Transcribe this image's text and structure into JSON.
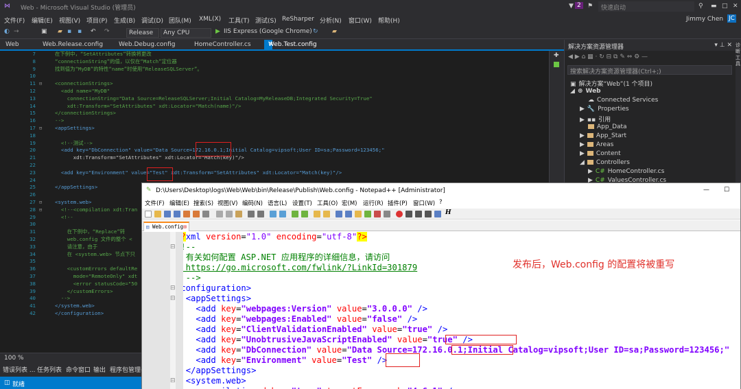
{
  "vs": {
    "title": "Web - Microsoft Visual Studio (管理员)",
    "notif_count": "2",
    "quick_launch": "快速启动",
    "user": "Jimmy Chen",
    "user_initials": "JC",
    "menu": [
      "文件(F)",
      "编辑(E)",
      "视图(V)",
      "项目(P)",
      "生成(B)",
      "调试(D)",
      "团队(M)",
      "XML(X)",
      "工具(T)",
      "测试(S)",
      "ReSharper",
      "分析(N)",
      "窗口(W)",
      "帮助(H)"
    ],
    "toolbar": {
      "config": "Release",
      "platform": "Any CPU",
      "run_label": "IIS Express (Google Chrome)"
    },
    "project_label": "Web",
    "tabs": [
      "Web.Release.config",
      "Web.Debug.config",
      "HomeController.cs",
      "Web.Test.config"
    ],
    "editor_lines": [
      {
        "n": "7",
        "text": "在下例中，“SetAttributes”转换将更改"
      },
      {
        "n": "8",
        "text": "“connectionString”的值，以仅在“Match”定位器"
      },
      {
        "n": "9",
        "text": "找到值为“MyDB”的特性“name”时使用“ReleaseSQLServer”。"
      },
      {
        "n": "10",
        "text": ""
      },
      {
        "n": "11",
        "text": "<connectionStrings>"
      },
      {
        "n": "12",
        "text": "  <add name=\"MyDB\""
      },
      {
        "n": "13",
        "text": "    connectionString=\"Data Source=ReleaseSQLServer;Initial Catalog=MyReleaseDB;Integrated Security=True\""
      },
      {
        "n": "14",
        "text": "    xdt:Transform=\"SetAttributes\" xdt:Locator=\"Match(name)\"/>"
      },
      {
        "n": "15",
        "text": "</connectionStrings>"
      },
      {
        "n": "16",
        "text": "-->"
      },
      {
        "n": "17",
        "text": "<appSettings>"
      },
      {
        "n": "18",
        "text": ""
      },
      {
        "n": "19",
        "text": "  <!--测试-->"
      },
      {
        "n": "20",
        "text": "  <add key=\"DbConnection\" value=\"Data Source=172.16.0.1;Initial Catalog=vipsoft;User ID=sa;Password=123456;\""
      },
      {
        "n": "21",
        "text": "      xdt:Transform=\"SetAttributes\" xdt:Locator=\"Match(key)\"/>"
      },
      {
        "n": "22",
        "text": ""
      },
      {
        "n": "23",
        "text": "  <add key=\"Environment\" value=\"Test\" xdt:Transform=\"SetAttributes\" xdt:Locator=\"Match(key)\"/>"
      },
      {
        "n": "24",
        "text": ""
      },
      {
        "n": "25",
        "text": "</appSettings>"
      },
      {
        "n": "26",
        "text": ""
      },
      {
        "n": "27",
        "text": "<system.web>"
      },
      {
        "n": "28",
        "text": "  <!--<compilation xdt:Tran"
      },
      {
        "n": "29",
        "text": "  <!--"
      },
      {
        "n": "30",
        "text": ""
      },
      {
        "n": "31",
        "text": "    在下例中，“Replace”转"
      },
      {
        "n": "32",
        "text": "    web.config 文件的整个 <"
      },
      {
        "n": "33",
        "text": "    请注意，由于"
      },
      {
        "n": "34",
        "text": "    在 <system.web> 节点下只"
      },
      {
        "n": "35",
        "text": ""
      },
      {
        "n": "36",
        "text": "    <customErrors defaultRe"
      },
      {
        "n": "37",
        "text": "      mode=\"RemoteOnly\" xdt"
      },
      {
        "n": "38",
        "text": "      <error statusCode=\"50"
      },
      {
        "n": "39",
        "text": "    </customErrors>"
      },
      {
        "n": "40",
        "text": "  -->"
      },
      {
        "n": "41",
        "text": "</system.web>"
      },
      {
        "n": "42",
        "text": "</configuration>"
      }
    ],
    "zoom": "100 %",
    "bottom_tabs": [
      "错误列表 ...",
      "任务列表",
      "命令窗口",
      "输出",
      "程序包管理器"
    ],
    "status": "就绪"
  },
  "solution": {
    "header": "解决方案资源管理器",
    "search_placeholder": "搜索解决方案资源管理器(Ctrl+;)",
    "root": "解决方案“Web”(1 个项目)",
    "project": "Web",
    "items": [
      "Connected Services",
      "Properties",
      "引用",
      "App_Data",
      "App_Start",
      "Areas",
      "Content",
      "Controllers",
      "HomeController.cs",
      "ValuesController.cs"
    ],
    "side_label": "诊断工具"
  },
  "npp": {
    "title": "D:\\Users\\Desktop\\logs\\Web\\Web\\bin\\Release\\Publish\\Web.config - Notepad++ [Administrator]",
    "menu": [
      "文件(F)",
      "编辑(E)",
      "搜索(S)",
      "视图(V)",
      "编码(N)",
      "语言(L)",
      "设置(T)",
      "工具(O)",
      "宏(M)",
      "运行(R)",
      "插件(P)",
      "窗口(W)",
      "?"
    ],
    "tab": "Web.config",
    "annotation": "发布后，Web.config 的配置将被重写"
  }
}
